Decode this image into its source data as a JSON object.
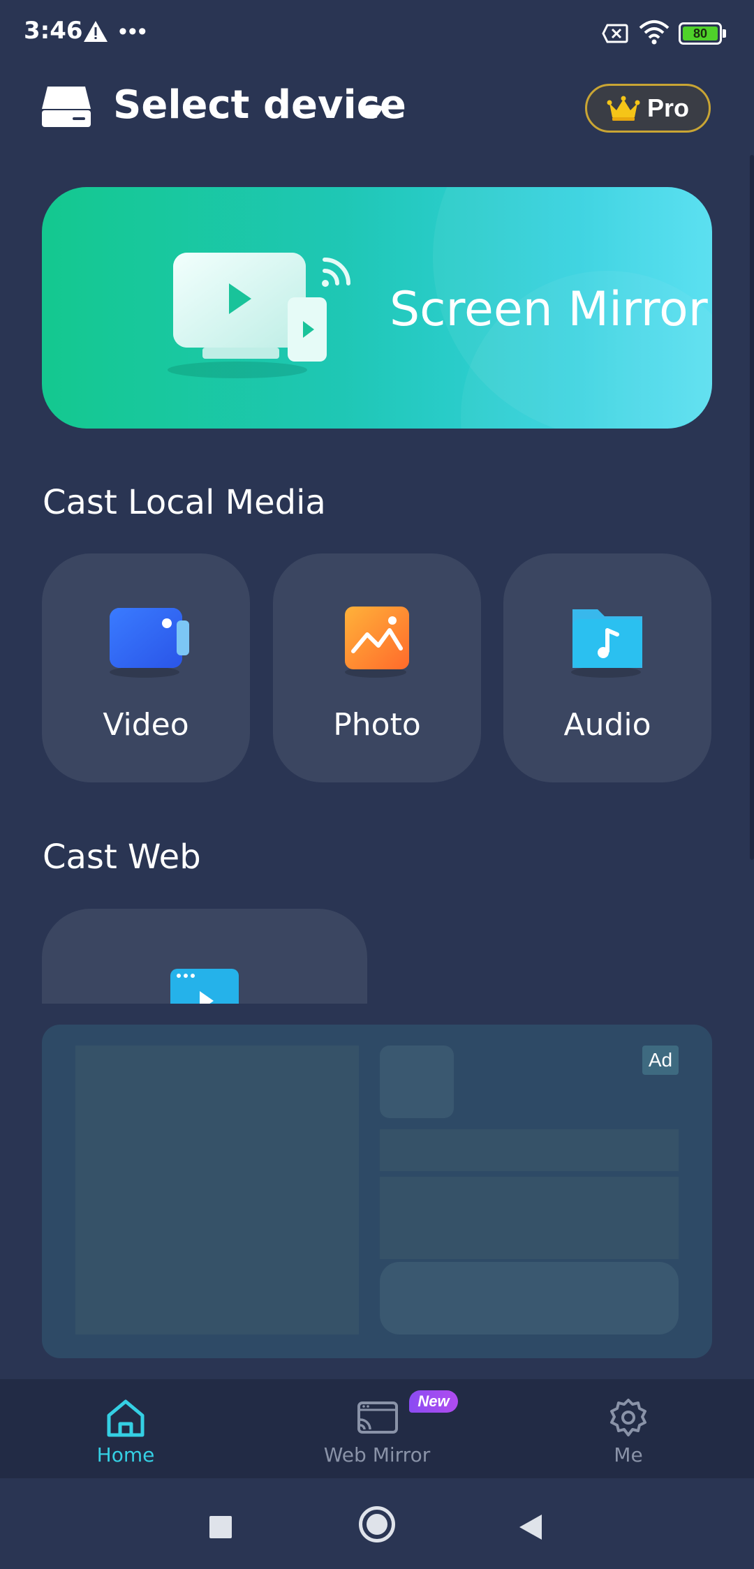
{
  "status_bar": {
    "time": "3:46",
    "battery_level": "80",
    "icons": [
      "warning-icon",
      "more-dots-icon",
      "no-sim-icon",
      "wifi-icon",
      "battery-icon"
    ]
  },
  "header": {
    "device_selector_label": "Select device",
    "pro_label": "Pro"
  },
  "mirror_banner": {
    "title": "Screen Mirror"
  },
  "cast_local_media": {
    "title": "Cast Local Media",
    "items": [
      {
        "label": "Video",
        "icon": "video-camera-icon"
      },
      {
        "label": "Photo",
        "icon": "photo-icon"
      },
      {
        "label": "Audio",
        "icon": "music-folder-icon"
      }
    ]
  },
  "cast_web": {
    "title": "Cast Web",
    "icon": "browser-play-icon"
  },
  "ad": {
    "badge": "Ad"
  },
  "bottom_nav": {
    "items": [
      {
        "label": "Home",
        "icon": "home-icon",
        "active": true
      },
      {
        "label": "Web Mirror",
        "icon": "cast-screen-icon",
        "active": false,
        "badge": "New"
      },
      {
        "label": "Me",
        "icon": "gear-icon",
        "active": false
      }
    ]
  },
  "colors": {
    "background": "#2a3553",
    "card": "#3b4661",
    "accent": "#35d0e4",
    "pro_border": "#c9a534",
    "banner_start": "#14c88f",
    "banner_end": "#52def0"
  }
}
